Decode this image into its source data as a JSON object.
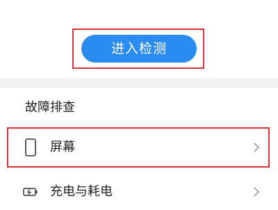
{
  "detect": {
    "button_label": "进入检测"
  },
  "troubleshoot": {
    "section_title": "故障排查",
    "items": [
      {
        "label": "屏幕",
        "icon": "phone-screen-icon"
      },
      {
        "label": "充电与耗电",
        "icon": "battery-charging-icon"
      }
    ]
  },
  "colors": {
    "accent": "#2a8cf0",
    "highlight": "#d7323c",
    "text": "#222222",
    "separator": "#f2f2f2"
  }
}
